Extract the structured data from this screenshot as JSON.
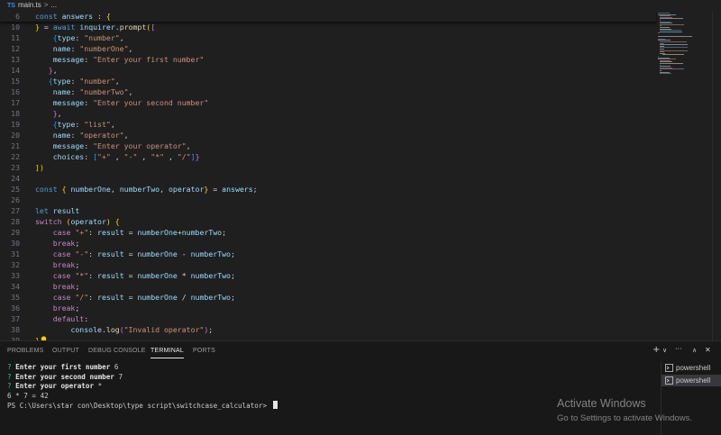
{
  "breadcrumb": {
    "file_icon": "TS",
    "file": "main.ts",
    "separator": ">",
    "rest": "..."
  },
  "editor": {
    "lines": [
      {
        "n": "6",
        "text": "const answers : {"
      },
      {
        "n": "10",
        "text": "} = await inquirer.prompt(["
      },
      {
        "n": "11",
        "text": "    {type: \"number\","
      },
      {
        "n": "12",
        "text": "    name: \"numberOne\","
      },
      {
        "n": "13",
        "text": "    message: \"Enter your first number\""
      },
      {
        "n": "14",
        "text": "   },"
      },
      {
        "n": "15",
        "text": "   {type: \"number\","
      },
      {
        "n": "16",
        "text": "    name: \"numberTwo\","
      },
      {
        "n": "17",
        "text": "    message: \"Enter your second number\""
      },
      {
        "n": "18",
        "text": "    },"
      },
      {
        "n": "19",
        "text": "    {type: \"list\","
      },
      {
        "n": "20",
        "text": "    name: \"operator\","
      },
      {
        "n": "21",
        "text": "    message: \"Enter your operator\","
      },
      {
        "n": "22",
        "text": "    choices: [\"+\" , \"-\" , \"*\" , \"/\"]}"
      },
      {
        "n": "23",
        "text": "])"
      },
      {
        "n": "24",
        "text": ""
      },
      {
        "n": "25",
        "text": "const { numberOne, numberTwo, operator} = answers;"
      },
      {
        "n": "26",
        "text": ""
      },
      {
        "n": "27",
        "text": "let result"
      },
      {
        "n": "28",
        "text": "switch (operator) {"
      },
      {
        "n": "29",
        "text": "    case \"+\": result = numberOne+numberTwo;"
      },
      {
        "n": "30",
        "text": "    break;"
      },
      {
        "n": "31",
        "text": "    case \"-\": result = numberOne - numberTwo;"
      },
      {
        "n": "32",
        "text": "    break;"
      },
      {
        "n": "33",
        "text": "    case \"*\": result = numberOne * numberTwo;"
      },
      {
        "n": "34",
        "text": "    break;"
      },
      {
        "n": "35",
        "text": "    case \"/\": result = numberOne / numberTwo;"
      },
      {
        "n": "36",
        "text": "    break;"
      },
      {
        "n": "37",
        "text": "    default:"
      },
      {
        "n": "38",
        "text": "        console.log(\"Invalid operator\");"
      },
      {
        "n": "39",
        "text": "}"
      }
    ]
  },
  "panel": {
    "tabs": [
      "PROBLEMS",
      "OUTPUT",
      "DEBUG CONSOLE",
      "TERMINAL",
      "PORTS"
    ],
    "active_tab": "TERMINAL",
    "actions": {
      "add": "+",
      "dropdown": "∨",
      "more": "···",
      "maximize": "∧",
      "close": "✕"
    },
    "terminal_lines": [
      {
        "prefix": "? ",
        "label": "Enter your first number",
        "value": " 6"
      },
      {
        "prefix": "? ",
        "label": "Enter your second number",
        "value": " 7"
      },
      {
        "prefix": "? ",
        "label": "Enter your operator",
        "value": " *"
      },
      {
        "prefix": "",
        "label": "",
        "value": "6 * 7 = 42"
      },
      {
        "prefix": "",
        "label": "",
        "value": "PS C:\\Users\\star con\\Desktop\\type script\\switchcase_calculator> "
      }
    ],
    "terminal_list": [
      "powershell",
      "powershell"
    ],
    "terminal_list_selected": 1
  },
  "watermark": {
    "title": "Activate Windows",
    "subtitle": "Go to Settings to activate Windows."
  },
  "colors": {
    "keyword": "#569cd6",
    "control": "#c586c0",
    "string": "#ce9178",
    "variable": "#9cdcfe",
    "function": "#dcdcaa",
    "prompt_marker": "#23d18b"
  }
}
